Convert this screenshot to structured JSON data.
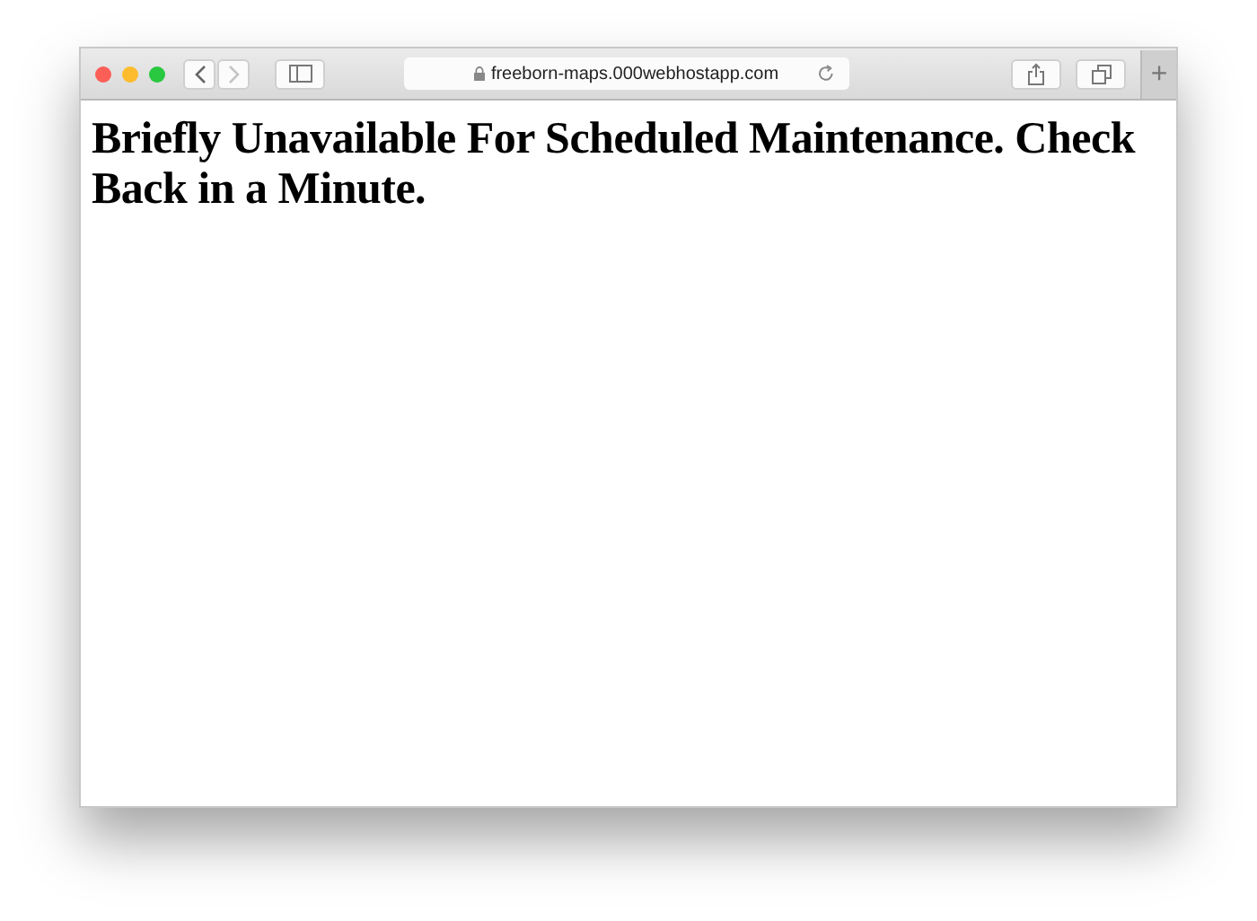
{
  "toolbar": {
    "nav": [
      {
        "kind": "back",
        "disabled": false
      },
      {
        "kind": "forward",
        "disabled": true
      }
    ],
    "address": "freeborn-maps.000webhostapp.com",
    "new_tab": "+"
  },
  "page": {
    "heading": "Briefly Unavailable For Scheduled Maintenance. Check Back in a Minute."
  }
}
